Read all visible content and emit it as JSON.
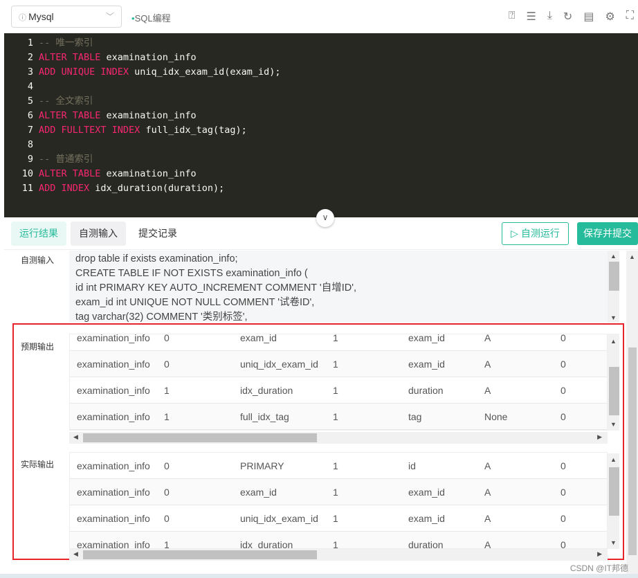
{
  "toolbar": {
    "db_select": "Mysql",
    "mode": "SQL编程",
    "icons": [
      "help-icon",
      "list-icon",
      "download-icon",
      "refresh-icon",
      "calendar-icon",
      "gear-icon",
      "fullscreen-icon"
    ]
  },
  "editor": {
    "lines": [
      [
        {
          "t": "-- 唯一索引",
          "c": "cm"
        }
      ],
      [
        {
          "t": "ALTER TABLE",
          "c": "kw"
        },
        {
          "t": " examination_info"
        }
      ],
      [
        {
          "t": "ADD UNIQUE INDEX",
          "c": "kw"
        },
        {
          "t": " uniq_idx_exam_id(exam_id);"
        }
      ],
      [],
      [
        {
          "t": "-- 全文索引",
          "c": "cm"
        }
      ],
      [
        {
          "t": "ALTER TABLE",
          "c": "kw"
        },
        {
          "t": " examination_info"
        }
      ],
      [
        {
          "t": "ADD FULLTEXT INDEX",
          "c": "kw"
        },
        {
          "t": " full_idx_tag(tag);"
        }
      ],
      [],
      [
        {
          "t": "-- 普通索引",
          "c": "cm"
        }
      ],
      [
        {
          "t": "ALTER TABLE",
          "c": "kw"
        },
        {
          "t": " examination_info"
        }
      ],
      [
        {
          "t": "ADD INDEX",
          "c": "kw"
        },
        {
          "t": " idx_duration(duration);"
        }
      ]
    ]
  },
  "tabs": [
    "运行结果",
    "自测输入",
    "提交记录"
  ],
  "buttons": {
    "run": "自测运行",
    "submit": "保存并提交"
  },
  "self_input": {
    "label": "自测输入",
    "lines": [
      "drop table if exists examination_info;",
      "CREATE TABLE IF NOT EXISTS examination_info (",
      "id int PRIMARY KEY AUTO_INCREMENT COMMENT '自增ID',",
      "exam_id int UNIQUE NOT NULL COMMENT '试卷ID',",
      "tag varchar(32) COMMENT '类别标签',"
    ]
  },
  "expected": {
    "label": "预期输出",
    "rows": [
      [
        "examination_info",
        "0",
        "exam_id",
        "1",
        "exam_id",
        "A",
        "0"
      ],
      [
        "examination_info",
        "0",
        "uniq_idx_exam_id",
        "1",
        "exam_id",
        "A",
        "0"
      ],
      [
        "examination_info",
        "1",
        "idx_duration",
        "1",
        "duration",
        "A",
        "0"
      ],
      [
        "examination_info",
        "1",
        "full_idx_tag",
        "1",
        "tag",
        "None",
        "0"
      ]
    ]
  },
  "actual": {
    "label": "实际输出",
    "rows": [
      [
        "examination_info",
        "0",
        "PRIMARY",
        "1",
        "id",
        "A",
        "0"
      ],
      [
        "examination_info",
        "0",
        "exam_id",
        "1",
        "exam_id",
        "A",
        "0"
      ],
      [
        "examination_info",
        "0",
        "uniq_idx_exam_id",
        "1",
        "exam_id",
        "A",
        "0"
      ],
      [
        "examination_info",
        "1",
        "idx_duration",
        "1",
        "duration",
        "A",
        "0"
      ]
    ]
  },
  "watermark": "CSDN @IT邦德",
  "colors": {
    "accent": "#25bb9b",
    "highlight_box": "#e8232a",
    "editor_bg": "#272822",
    "keyword": "#f92672"
  }
}
